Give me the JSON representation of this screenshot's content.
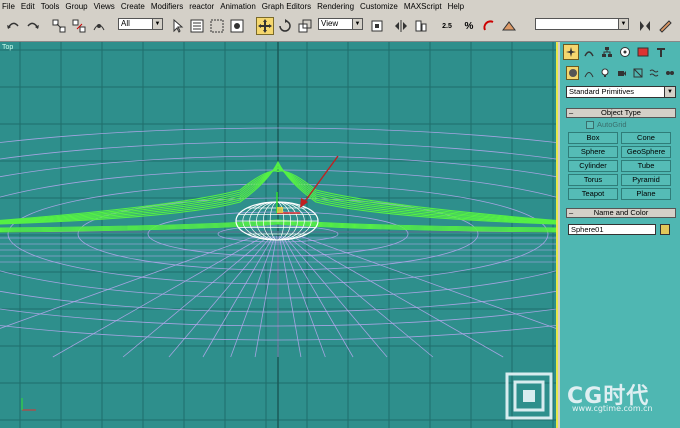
{
  "menu": [
    "File",
    "Edit",
    "Tools",
    "Group",
    "Views",
    "Create",
    "Modifiers",
    "reactor",
    "Animation",
    "Graph Editors",
    "Rendering",
    "Customize",
    "MAXScript",
    "Help"
  ],
  "toolbar": {
    "selection_filter": "All",
    "reference_coord": "View",
    "snap_angle": "2.5",
    "percent_snap": "%"
  },
  "viewport": {
    "label": "Top"
  },
  "panel": {
    "category_dropdown": "Standard Primitives",
    "object_type_title": "Object Type",
    "autogrid_label": "AutoGrid",
    "buttons": [
      "Box",
      "Cone",
      "Sphere",
      "GeoSphere",
      "Cylinder",
      "Tube",
      "Torus",
      "Pyramid",
      "Teapot",
      "Plane"
    ],
    "name_color_title": "Name and Color",
    "object_name": "Sphere01",
    "object_color": "#e2c85a"
  },
  "watermark": {
    "logo": "CG时代",
    "url": "www.cgtime.com.cn"
  },
  "colors": {
    "viewport_bg": "#2e8f8c",
    "grid_line": "#1f6e6b",
    "green_mesh": "#55f045",
    "purple_mesh": "#b9a8f0",
    "panel_bg": "#4fb7b2"
  }
}
